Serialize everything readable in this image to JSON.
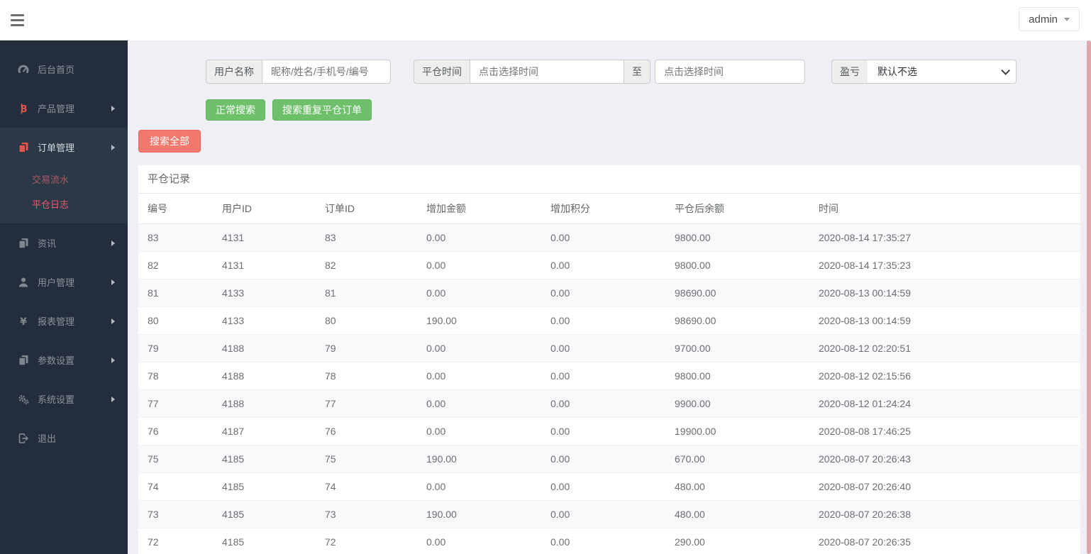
{
  "topbar": {
    "user": "admin"
  },
  "sidebar": {
    "items": [
      {
        "key": "home",
        "label": "后台首页",
        "icon": "dashboard-icon",
        "arrow": false,
        "red_icon": false,
        "active": false
      },
      {
        "key": "products",
        "label": "产品管理",
        "icon": "bitcoin-icon",
        "arrow": true,
        "red_icon": true,
        "active": false
      },
      {
        "key": "orders",
        "label": "订单管理",
        "icon": "document-icon",
        "arrow": true,
        "red_icon": true,
        "active": true,
        "children": [
          {
            "key": "trade-flow",
            "label": "交易流水",
            "active": false
          },
          {
            "key": "close-log",
            "label": "平仓日志",
            "active": true
          }
        ]
      },
      {
        "key": "news",
        "label": "资讯",
        "icon": "document-icon",
        "arrow": true,
        "red_icon": false,
        "active": false
      },
      {
        "key": "users",
        "label": "用户管理",
        "icon": "user-icon",
        "arrow": true,
        "red_icon": false,
        "active": false
      },
      {
        "key": "reports",
        "label": "报表管理",
        "icon": "yen-icon",
        "arrow": true,
        "red_icon": false,
        "active": false
      },
      {
        "key": "params",
        "label": "参数设置",
        "icon": "document-icon",
        "arrow": true,
        "red_icon": false,
        "active": false
      },
      {
        "key": "system",
        "label": "系统设置",
        "icon": "gear-icon",
        "arrow": true,
        "red_icon": false,
        "active": false
      },
      {
        "key": "logout",
        "label": "退出",
        "icon": "logout-icon",
        "arrow": false,
        "red_icon": false,
        "active": false
      }
    ]
  },
  "filters": {
    "username_label": "用户名称",
    "username_placeholder": "昵称/姓名/手机号/编号",
    "time_label": "平仓时间",
    "time_placeholder": "点击选择时间",
    "to_label": "至",
    "time2_placeholder": "点击选择时间",
    "pl_label": "盈亏",
    "pl_selected": "默认不选"
  },
  "buttons": {
    "normal_search": "正常搜索",
    "dup_search": "搜索重复平仓订单",
    "search_all": "搜索全部"
  },
  "table": {
    "title": "平仓记录",
    "headers": [
      "编号",
      "用户ID",
      "订单ID",
      "增加金额",
      "增加积分",
      "平仓后余额",
      "时间"
    ],
    "rows": [
      [
        "83",
        "4131",
        "83",
        "0.00",
        "0.00",
        "9800.00",
        "2020-08-14 17:35:27"
      ],
      [
        "82",
        "4131",
        "82",
        "0.00",
        "0.00",
        "9800.00",
        "2020-08-14 17:35:23"
      ],
      [
        "81",
        "4133",
        "81",
        "0.00",
        "0.00",
        "98690.00",
        "2020-08-13 00:14:59"
      ],
      [
        "80",
        "4133",
        "80",
        "190.00",
        "0.00",
        "98690.00",
        "2020-08-13 00:14:59"
      ],
      [
        "79",
        "4188",
        "79",
        "0.00",
        "0.00",
        "9700.00",
        "2020-08-12 02:20:51"
      ],
      [
        "78",
        "4188",
        "78",
        "0.00",
        "0.00",
        "9800.00",
        "2020-08-12 02:15:56"
      ],
      [
        "77",
        "4188",
        "77",
        "0.00",
        "0.00",
        "9900.00",
        "2020-08-12 01:24:24"
      ],
      [
        "76",
        "4187",
        "76",
        "0.00",
        "0.00",
        "19900.00",
        "2020-08-08 17:46:25"
      ],
      [
        "75",
        "4185",
        "75",
        "190.00",
        "0.00",
        "670.00",
        "2020-08-07 20:26:43"
      ],
      [
        "74",
        "4185",
        "74",
        "0.00",
        "0.00",
        "480.00",
        "2020-08-07 20:26:40"
      ],
      [
        "73",
        "4185",
        "73",
        "190.00",
        "0.00",
        "480.00",
        "2020-08-07 20:26:38"
      ],
      [
        "72",
        "4185",
        "72",
        "0.00",
        "0.00",
        "290.00",
        "2020-08-07 20:26:35"
      ]
    ]
  },
  "colors": {
    "sidebar_bg": "#232d3b",
    "sidebar_active_bg": "#2b3847",
    "accent_red_icon": "#e0564f",
    "active_link_pink": "#ef5a70",
    "green_button": "#6ec06a",
    "red_button": "#f3796f",
    "page_bg": "#eef0f5",
    "scrollbar_pink": "#dfa6ad"
  }
}
